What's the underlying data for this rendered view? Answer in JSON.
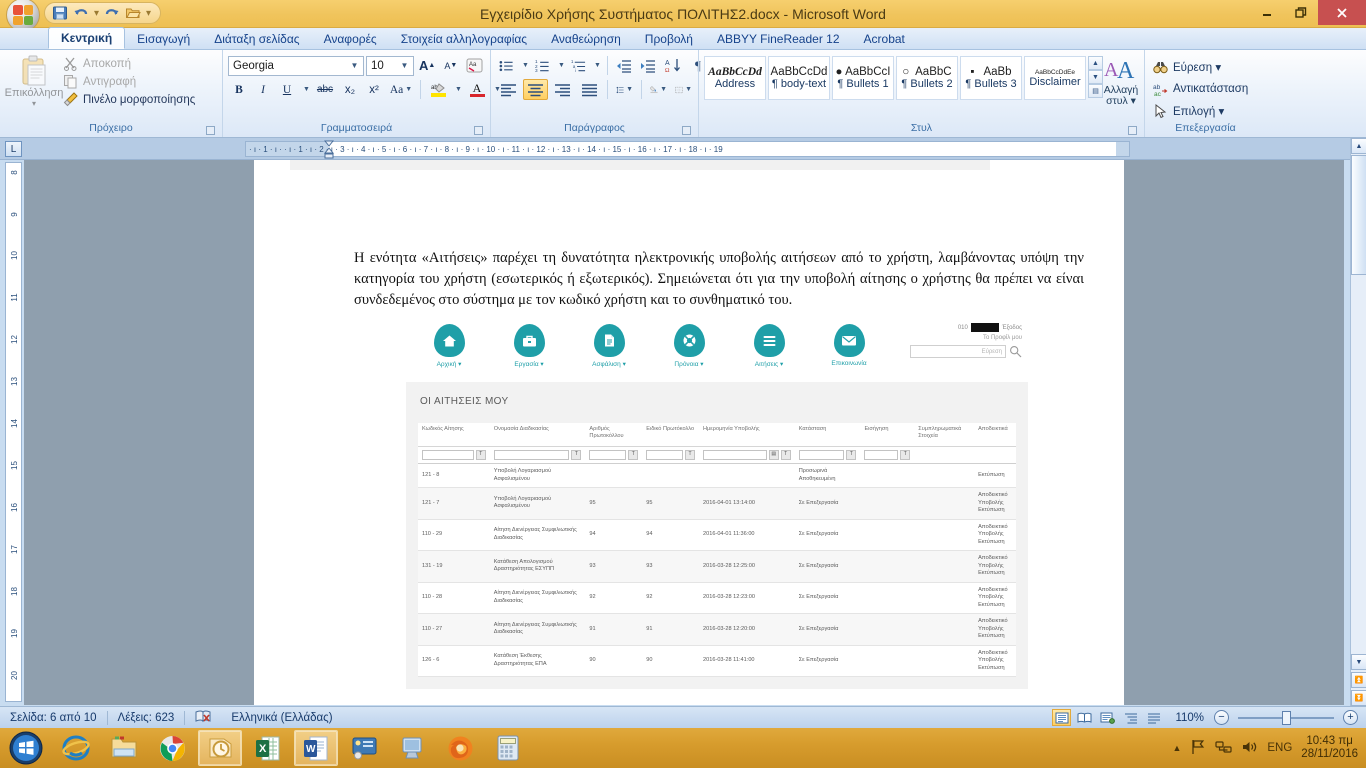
{
  "window": {
    "title": "Εγχειρίδιο Χρήσης Συστήματος ΠΟΛΙΤΗΣ2.docx  -  Microsoft Word",
    "minimize": "–",
    "restore": "❐",
    "close": "✕"
  },
  "quick_access": {
    "save": "save-icon",
    "undo": "undo-icon",
    "redo": "redo-icon",
    "open": "open-icon",
    "more": "▾"
  },
  "tabs": [
    {
      "label": "Κεντρική",
      "active": true
    },
    {
      "label": "Εισαγωγή",
      "active": false
    },
    {
      "label": "Διάταξη σελίδας",
      "active": false
    },
    {
      "label": "Αναφορές",
      "active": false
    },
    {
      "label": "Στοιχεία αλληλογραφίας",
      "active": false
    },
    {
      "label": "Αναθεώρηση",
      "active": false
    },
    {
      "label": "Προβολή",
      "active": false
    },
    {
      "label": "ABBYY FineReader 12",
      "active": false
    },
    {
      "label": "Acrobat",
      "active": false
    }
  ],
  "ribbon": {
    "clipboard": {
      "group_label": "Πρόχειρο",
      "paste": "Επικόλληση",
      "paste_arrow": "▾",
      "cut": "Αποκοπή",
      "copy": "Αντιγραφή",
      "format_painter": "Πινέλο μορφοποίησης"
    },
    "font": {
      "group_label": "Γραμματοσειρά",
      "font_family": "Georgia",
      "font_size": "10",
      "grow": "A",
      "shrink": "A",
      "clear_format": "Aa",
      "bold": "B",
      "italic": "I",
      "underline": "U",
      "strikethrough": "abc",
      "subscript": "x₂",
      "superscript": "x²",
      "change_case": "Aa",
      "highlight": "ab",
      "font_color": "A",
      "arrow": "▾"
    },
    "paragraph": {
      "group_label": "Παράγραφος",
      "bullets": "•",
      "numbering": "1.",
      "multilevel": "⋮",
      "dec_indent": "⇤",
      "inc_indent": "⇥",
      "sort": "A↓",
      "show_marks": "¶",
      "align_left": "≡",
      "align_center": "≡",
      "align_right": "≡",
      "justify": "≡",
      "line_spacing": "↕",
      "shading": "◨",
      "borders": "⊞"
    },
    "styles": {
      "group_label": "Στυλ",
      "items": [
        {
          "preview": "AaBbCcDd",
          "name": "Address",
          "italic": true,
          "bullet": ""
        },
        {
          "preview": "AaBbCcDd",
          "name": "¶ body-text",
          "italic": false,
          "bullet": ""
        },
        {
          "preview": "AaBbCcI",
          "name": "¶ Bullets 1",
          "italic": false,
          "bullet": "●"
        },
        {
          "preview": "AaBbC",
          "name": "¶ Bullets 2",
          "italic": false,
          "bullet": "○"
        },
        {
          "preview": "AaBb",
          "name": "¶ Bullets 3",
          "italic": false,
          "bullet": "▪"
        },
        {
          "preview": "AaBbCcDdEe",
          "name": "Disclaimer",
          "italic": false,
          "bullet": ""
        }
      ],
      "scroll_up": "▲",
      "scroll_down": "▼",
      "scroll_more": "▤",
      "change_styles": "Αλλαγή στυλ ▾"
    },
    "editing": {
      "group_label": "Επεξεργασία",
      "find": "Εύρεση ▾",
      "replace": "Αντικατάσταση",
      "select": "Επιλογή ▾"
    }
  },
  "ruler": {
    "corner_tab": "L",
    "horizontal_ticks": "·  ı  ·  1  ·  ı  ·      ·  ı  ·  1  ·  ı  ·  2  ·  ı  ·  3  ·  ı  ·  4  ·  ı  ·  5  ·  ı  ·  6  ·  ı  ·  7  ·  ı  ·  8  ·  ı  ·  9  ·  ı  ·  10  ·  ı  ·  11  ·  ı  ·  12  ·  ı  ·  13  ·  ı  ·  14  ·  ı  ·  15  ·  ı  ·  16  ·  ı  ·  17  ·  ı  ·  18  ·  ı  ·  19",
    "vertical_ticks": [
      "8",
      "9",
      "10",
      "11",
      "12",
      "13",
      "14",
      "15",
      "16",
      "17",
      "18",
      "19",
      "20"
    ]
  },
  "document": {
    "paragraph": "Η ενότητα «Αιτήσεις» παρέχει τη δυνατότητα ηλεκτρονικής υποβολής αιτήσεων από το χρήστη, λαμβάνοντας υπόψη την κατηγορία του χρήστη (εσωτερικός ή εξωτερικός). Σημειώνεται ότι για την υποβολή αίτησης ο χρήστης θα πρέπει να είναι συνδεδεμένος στο σύστημα με τον κωδικό χρήστη και το συνθηματικό του."
  },
  "embedded_app": {
    "nav": [
      {
        "label": "Αρχική ▾",
        "icon": "home-icon"
      },
      {
        "label": "Εργασία ▾",
        "icon": "briefcase-icon"
      },
      {
        "label": "Ασφάλιση ▾",
        "icon": "document-icon"
      },
      {
        "label": "Πρόνοια ▾",
        "icon": "lifebuoy-icon"
      },
      {
        "label": "Αιτήσεις ▾",
        "icon": "list-icon"
      },
      {
        "label": "Επικοινωνία",
        "icon": "envelope-icon"
      }
    ],
    "user": {
      "prefix": "010",
      "logout": "Έξοδος",
      "profile": "Το Προφίλ μου",
      "search_placeholder": "Εύρεση",
      "search_icon": "magnifier-icon"
    },
    "accent_color": "#1f9fa8",
    "panel_title": "ΟΙ ΑΙΤΗΣΕΙΣ ΜΟΥ",
    "columns": [
      "Κωδικός Αίτησης",
      "Ονομασία Διαδικασίας",
      "Αριθμός Πρωτοκόλλου",
      "Ειδικό Πρωτόκολλο",
      "Ημερομηνία Υποβολής",
      "Κατάσταση",
      "Εισήγηση",
      "Συμπληρωματικά Στοιχεία",
      "Αποδεικτικά"
    ],
    "filter_button": "T",
    "filter_calendar": "▤",
    "rows": [
      {
        "code": "121 - 8",
        "process": "Υποβολή Λογαριασμού Ασφαλισμένου",
        "protocol": "",
        "special_protocol": "",
        "submitted": "",
        "status": "Προσωρινά Αποθηκευμένη",
        "recommendation": "",
        "extra": "",
        "proof": [
          "Εκτύπωση"
        ]
      },
      {
        "code": "121 - 7",
        "process": "Υποβολή Λογαριασμού Ασφαλισμένου",
        "protocol": "95",
        "special_protocol": "95",
        "submitted": "2016-04-01 13:14:00",
        "status": "Σε Επεξεργασία",
        "recommendation": "",
        "extra": "",
        "proof": [
          "Αποδεικτικό",
          "Υποβολής",
          "Εκτύπωση"
        ]
      },
      {
        "code": "110 - 29",
        "process": "Αίτηση Διενέργειας Συμφιλιωτικής Διαδικασίας",
        "protocol": "94",
        "special_protocol": "94",
        "submitted": "2016-04-01 11:36:00",
        "status": "Σε Επεξεργασία",
        "recommendation": "",
        "extra": "",
        "proof": [
          "Αποδεικτικό",
          "Υποβολής",
          "Εκτύπωση"
        ]
      },
      {
        "code": "131 - 19",
        "process": "Κατάθεση Απολογισμού Δραστηριότητας ΕΣΥΠΠ",
        "protocol": "93",
        "special_protocol": "93",
        "submitted": "2016-03-28 12:25:00",
        "status": "Σε Επεξεργασία",
        "recommendation": "",
        "extra": "",
        "proof": [
          "Αποδεικτικό",
          "Υποβολής",
          "Εκτύπωση"
        ]
      },
      {
        "code": "110 - 28",
        "process": "Αίτηση Διενέργειας Συμφιλιωτικής Διαδικασίας",
        "protocol": "92",
        "special_protocol": "92",
        "submitted": "2016-03-28 12:23:00",
        "status": "Σε Επεξεργασία",
        "recommendation": "",
        "extra": "",
        "proof": [
          "Αποδεικτικό",
          "Υποβολής",
          "Εκτύπωση"
        ]
      },
      {
        "code": "110 - 27",
        "process": "Αίτηση Διενέργειας Συμφιλιωτικής Διαδικασίας",
        "protocol": "91",
        "special_protocol": "91",
        "submitted": "2016-03-28 12:20:00",
        "status": "Σε Επεξεργασία",
        "recommendation": "",
        "extra": "",
        "proof": [
          "Αποδεικτικό",
          "Υποβολής",
          "Εκτύπωση"
        ]
      },
      {
        "code": "126 - 6",
        "process": "Κατάθεση Έκθεσης Δραστηριότητας ΕΠΑ",
        "protocol": "90",
        "special_protocol": "90",
        "submitted": "2016-03-28 11:41:00",
        "status": "Σε Επεξεργασία",
        "recommendation": "",
        "extra": "",
        "proof": [
          "Αποδεικτικό",
          "Υποβολής",
          "Εκτύπωση"
        ]
      }
    ]
  },
  "statusbar": {
    "page": "Σελίδα: 6 από 10",
    "words": "Λέξεις: 623",
    "proofing_icon": "spellcheck-icon",
    "language": "Ελληνικά (Ελλάδας)",
    "zoom": "110%",
    "zoom_out": "−",
    "zoom_in": "+",
    "views": [
      "print-layout-view",
      "full-screen-view",
      "web-layout-view",
      "outline-view",
      "draft-view"
    ]
  },
  "taskbar": {
    "start": "start-orb",
    "apps": [
      {
        "name": "internet-explorer-icon",
        "running": false
      },
      {
        "name": "file-explorer-icon",
        "running": false
      },
      {
        "name": "google-chrome-icon",
        "running": false
      },
      {
        "name": "outlook-icon",
        "running": true
      },
      {
        "name": "excel-icon",
        "running": false
      },
      {
        "name": "word-icon",
        "running": true
      },
      {
        "name": "remote-desktop-icon",
        "running": false
      },
      {
        "name": "computer-icon",
        "running": false
      },
      {
        "name": "firefox-icon",
        "running": false
      },
      {
        "name": "calculator-icon",
        "running": false
      }
    ],
    "tray": {
      "show_hidden": "▲",
      "network": "network-icon",
      "action_center": "flag-icon",
      "volume": "volume-icon",
      "language": "ENG",
      "time": "10:43 πμ",
      "date": "28/11/2016"
    }
  }
}
